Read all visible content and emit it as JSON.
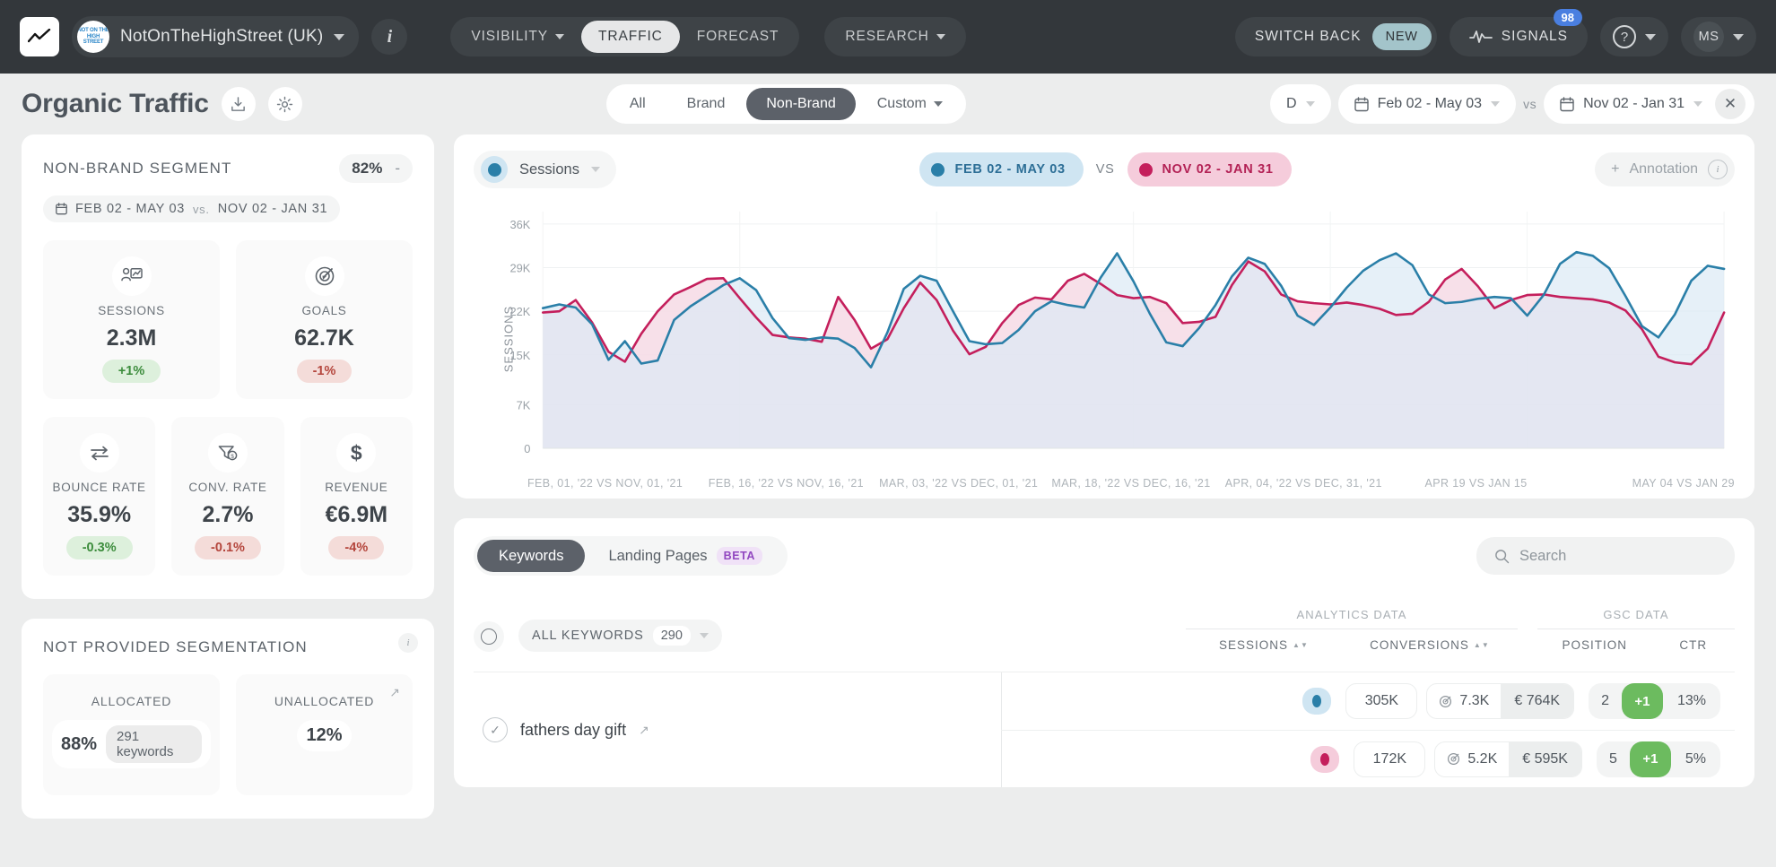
{
  "topbar": {
    "account_name": "NotOnTheHighStreet (UK)",
    "account_logo_text": "NOT ON THE HIGH STREET",
    "info_icon": "i",
    "nav": [
      {
        "label": "VISIBILITY",
        "caret": true,
        "active": false
      },
      {
        "label": "TRAFFIC",
        "caret": false,
        "active": true
      },
      {
        "label": "FORECAST",
        "caret": false,
        "active": false
      }
    ],
    "research_label": "RESEARCH",
    "switch_back_label": "SWITCH BACK",
    "new_badge": "NEW",
    "signals_label": "SIGNALS",
    "signals_count": "98",
    "help_glyph": "?",
    "user_initials": "MS"
  },
  "subheader": {
    "title": "Organic Traffic",
    "export_icon": "download-icon",
    "settings_icon": "gear-icon",
    "segments": [
      {
        "label": "All",
        "active": false,
        "caret": false
      },
      {
        "label": "Brand",
        "active": false,
        "caret": false
      },
      {
        "label": "Non-Brand",
        "active": true,
        "caret": false
      },
      {
        "label": "Custom",
        "active": false,
        "caret": true
      }
    ],
    "granularity": "D",
    "date_primary": "Feb 02 - May 03",
    "vs": "vs",
    "date_compare": "Nov 02 - Jan 31",
    "close_glyph": "✕"
  },
  "segment_card": {
    "title": "NON-BRAND SEGMENT",
    "share_pct": "82%",
    "share_delta": "-",
    "range_primary": "FEB 02 - MAY 03",
    "range_vs": "vs.",
    "range_compare": "NOV 02 - JAN 31",
    "kpis_top": [
      {
        "icon": "sessions-icon",
        "label": "SESSIONS",
        "value": "2.3M",
        "delta": "+1%",
        "dir": "up"
      },
      {
        "icon": "goals-icon",
        "label": "GOALS",
        "value": "62.7K",
        "delta": "-1%",
        "dir": "down"
      }
    ],
    "kpis_bottom": [
      {
        "icon": "bounce-rate-icon",
        "label": "BOUNCE RATE",
        "value": "35.9%",
        "delta": "-0.3%",
        "dir": "up"
      },
      {
        "icon": "conversion-rate-icon",
        "label": "CONV. RATE",
        "value": "2.7%",
        "delta": "-0.1%",
        "dir": "down"
      },
      {
        "icon": "revenue-icon",
        "label": "REVENUE",
        "value": "€6.9M",
        "delta": "-4%",
        "dir": "down"
      }
    ]
  },
  "not_provided": {
    "title": "NOT PROVIDED SEGMENTATION",
    "info_glyph": "i",
    "allocated_label": "ALLOCATED",
    "allocated_pct": "88%",
    "allocated_sub": "291 keywords",
    "unallocated_label": "UNALLOCATED",
    "unallocated_pct": "12%"
  },
  "chart_header": {
    "metric": "Sessions",
    "legend_a": "FEB 02 - MAY 03",
    "legend_vs": "VS",
    "legend_b": "NOV 02 - JAN 31",
    "annotation_label": "Annotation",
    "annotation_plus": "+",
    "annotation_info": "i"
  },
  "colors": {
    "series_a": "#2a7fa8",
    "series_b": "#c41f5c",
    "series_a_fill": "#dbeaf5",
    "series_b_fill": "#f6dbe5",
    "accent_dark": "#5c6169",
    "positive": "#6cbb5f",
    "delta_up_bg": "#ddf0dc",
    "delta_down_bg": "#f4dcd9"
  },
  "chart_data": {
    "type": "line",
    "title": "Sessions",
    "ylabel": "SESSIONS",
    "xlabel": "",
    "ylim": [
      0,
      38000
    ],
    "yticks": [
      0,
      7000,
      15000,
      22000,
      29000,
      36000
    ],
    "ytick_labels": [
      "0",
      "7K",
      "15K",
      "22K",
      "29K",
      "36K"
    ],
    "grid": true,
    "legend_position": "top-center",
    "xtick_labels": [
      "FEB, 01, '22 VS NOV, 01, '21",
      "FEB, 16, '22 VS NOV, 16, '21",
      "MAR, 03, '22 VS DEC, 01, '21",
      "MAR, 18, '22 VS DEC, 16, '21",
      "APR, 04, '22 VS DEC, 31, '21",
      "APR 19 VS JAN 15",
      "MAY 04 VS JAN 29"
    ],
    "series": [
      {
        "name": "FEB 02 - MAY 03",
        "color": "#2a7fa8",
        "values": [
          22500,
          23100,
          22600,
          19900,
          14200,
          17200,
          13600,
          14100,
          20600,
          22800,
          24500,
          26200,
          27300,
          25400,
          20900,
          17700,
          17400,
          17800,
          17600,
          16100,
          13000,
          18600,
          25600,
          27700,
          26900,
          22000,
          17200,
          16700,
          16900,
          19000,
          22000,
          23600,
          23000,
          22600,
          27400,
          31300,
          26800,
          21600,
          17000,
          16400,
          19300,
          23000,
          27600,
          30600,
          29600,
          26100,
          21300,
          19800,
          22600,
          25800,
          28500,
          30200,
          31300,
          29400,
          24700,
          23300,
          23500,
          24000,
          24300,
          24100,
          21300,
          24600,
          29600,
          31500,
          30900,
          28900,
          24400,
          19600,
          17800,
          21500,
          26900,
          29300,
          28800
        ]
      },
      {
        "name": "NOV 02 - JAN 31",
        "color": "#c41f5c",
        "values": [
          21800,
          22000,
          23800,
          20200,
          15500,
          13900,
          18400,
          22000,
          24700,
          25900,
          27200,
          27300,
          24100,
          21000,
          18200,
          17800,
          17600,
          17100,
          24300,
          20600,
          16000,
          17500,
          22500,
          26600,
          23800,
          18900,
          15100,
          16300,
          20100,
          23000,
          24200,
          23900,
          26900,
          28000,
          26400,
          24600,
          24100,
          24300,
          23300,
          20100,
          20300,
          21100,
          26200,
          30000,
          28400,
          24700,
          23600,
          23300,
          23100,
          23400,
          23000,
          22400,
          21400,
          21600,
          23500,
          27100,
          28800,
          26000,
          22500,
          23800,
          24600,
          24700,
          24300,
          24100,
          23900,
          23400,
          22100,
          19100,
          14700,
          13800,
          13500,
          16000,
          21800
        ]
      }
    ]
  },
  "table": {
    "tabs": [
      {
        "label": "Keywords",
        "active": true,
        "badge": null
      },
      {
        "label": "Landing Pages",
        "active": false,
        "badge": "BETA"
      }
    ],
    "search_placeholder": "Search",
    "search_icon": "search-icon",
    "filter_label": "ALL KEYWORDS",
    "filter_count": "290",
    "column_groups": [
      {
        "title": "ANALYTICS DATA",
        "columns": [
          {
            "label": "SESSIONS",
            "sortable": true
          },
          {
            "label": "CONVERSIONS",
            "sortable": true
          }
        ]
      },
      {
        "title": "GSC DATA",
        "columns": [
          {
            "label": "POSITION",
            "sortable": false
          },
          {
            "label": "CTR",
            "sortable": false
          }
        ]
      }
    ],
    "rows": [
      {
        "keyword": "fathers day gift",
        "metrics": [
          {
            "series": "a",
            "sessions": "305K",
            "conversions": "7.3K",
            "revenue": "€ 764K",
            "position": "2",
            "position_delta": "+1",
            "ctr": "13%"
          },
          {
            "series": "b",
            "sessions": "172K",
            "conversions": "5.2K",
            "revenue": "€ 595K",
            "position": "5",
            "position_delta": "+1",
            "ctr": "5%"
          }
        ]
      }
    ]
  }
}
